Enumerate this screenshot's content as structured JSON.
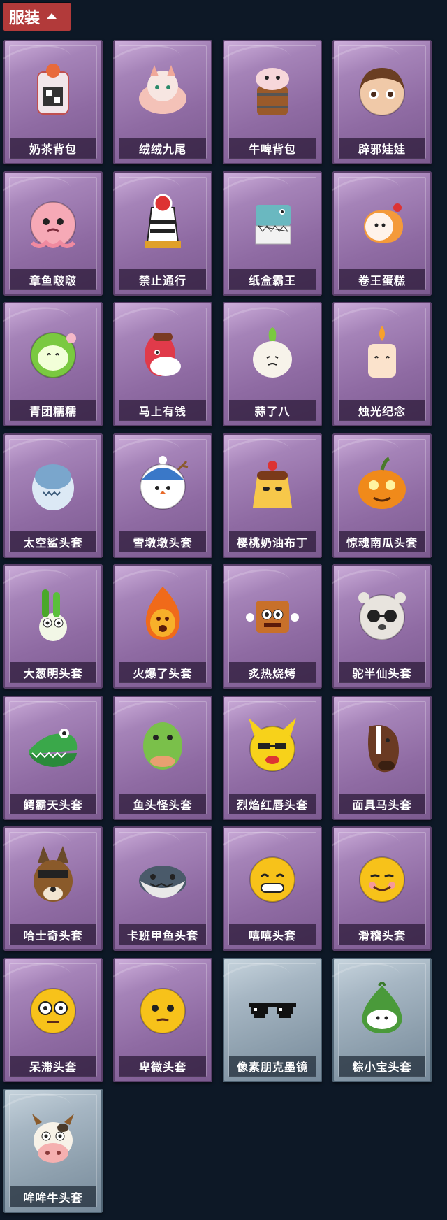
{
  "section": {
    "title": "服装",
    "icon": "chevron-up-icon"
  },
  "items": [
    {
      "label": "奶茶背包",
      "icon": "milk-tea-backpack-icon",
      "rarity": "purple"
    },
    {
      "label": "绒绒九尾",
      "icon": "nine-tailed-fox-icon",
      "rarity": "purple"
    },
    {
      "label": "牛啤背包",
      "icon": "cow-beer-backpack-icon",
      "rarity": "purple"
    },
    {
      "label": "辟邪娃娃",
      "icon": "doll-head-icon",
      "rarity": "purple"
    },
    {
      "label": "章鱼啵啵",
      "icon": "octopus-icon",
      "rarity": "purple"
    },
    {
      "label": "禁止通行",
      "icon": "no-entry-sign-icon",
      "rarity": "purple"
    },
    {
      "label": "纸盒霸王",
      "icon": "cardboard-dinosaur-icon",
      "rarity": "purple"
    },
    {
      "label": "卷王蛋糕",
      "icon": "roll-cake-icon",
      "rarity": "purple"
    },
    {
      "label": "青团糯糯",
      "icon": "green-dumpling-icon",
      "rarity": "purple"
    },
    {
      "label": "马上有钱",
      "icon": "red-horse-icon",
      "rarity": "purple"
    },
    {
      "label": "蒜了八",
      "icon": "garlic-icon",
      "rarity": "purple"
    },
    {
      "label": "烛光纪念",
      "icon": "candle-icon",
      "rarity": "purple"
    },
    {
      "label": "太空鲨头套",
      "icon": "space-shark-head-icon",
      "rarity": "purple"
    },
    {
      "label": "雪墩墩头套",
      "icon": "snowman-head-icon",
      "rarity": "purple"
    },
    {
      "label": "樱桃奶油布丁",
      "icon": "pudding-icon",
      "rarity": "purple"
    },
    {
      "label": "惊魂南瓜头套",
      "icon": "pumpkin-head-icon",
      "rarity": "purple"
    },
    {
      "label": "大葱明头套",
      "icon": "scallion-head-icon",
      "rarity": "purple"
    },
    {
      "label": "火爆了头套",
      "icon": "fire-head-icon",
      "rarity": "purple"
    },
    {
      "label": "炙热烧烤",
      "icon": "bbq-head-icon",
      "rarity": "purple"
    },
    {
      "label": "驼半仙头套",
      "icon": "sunglasses-bear-head-icon",
      "rarity": "purple"
    },
    {
      "label": "鳄霸天头套",
      "icon": "crocodile-head-icon",
      "rarity": "purple"
    },
    {
      "label": "鱼头怪头套",
      "icon": "fish-head-icon",
      "rarity": "purple"
    },
    {
      "label": "烈焰红唇头套",
      "icon": "yellow-mouse-head-icon",
      "rarity": "purple"
    },
    {
      "label": "面具马头套",
      "icon": "horse-mask-icon",
      "rarity": "purple"
    },
    {
      "label": "哈士奇头套",
      "icon": "husky-head-icon",
      "rarity": "purple"
    },
    {
      "label": "卡班甲鱼头套",
      "icon": "turtle-head-icon",
      "rarity": "purple"
    },
    {
      "label": "嘻嘻头套",
      "icon": "grin-emoji-head-icon",
      "rarity": "purple"
    },
    {
      "label": "滑稽头套",
      "icon": "funny-emoji-head-icon",
      "rarity": "purple"
    },
    {
      "label": "呆滞头套",
      "icon": "dazed-emoji-head-icon",
      "rarity": "purple"
    },
    {
      "label": "卑微头套",
      "icon": "humble-emoji-head-icon",
      "rarity": "purple"
    },
    {
      "label": "像素朋克墨镜",
      "icon": "pixel-sunglasses-icon",
      "rarity": "silver"
    },
    {
      "label": "粽小宝头套",
      "icon": "zongzi-head-icon",
      "rarity": "silver"
    },
    {
      "label": "哞哞牛头套",
      "icon": "cow-head-icon",
      "rarity": "silver"
    }
  ]
}
